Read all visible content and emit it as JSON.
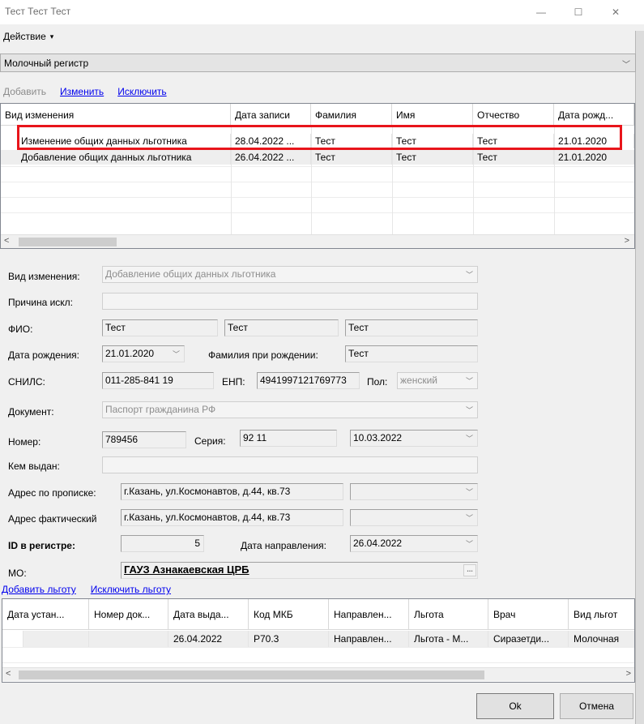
{
  "window": {
    "title": "Тест Тест Тест",
    "min_glyph": "—",
    "max_glyph": "☐",
    "close_glyph": "✕"
  },
  "menu": {
    "action_label": "Действие",
    "caret": "▾"
  },
  "registry": {
    "value": "Молочный регистр",
    "arrow": "﹀"
  },
  "toolbar": {
    "add": "Добавить",
    "edit": "Изменить",
    "exclude": "Исключить"
  },
  "changes_grid": {
    "columns": [
      "Вид изменения",
      "Дата записи",
      "Фамилия",
      "Имя",
      "Отчество",
      "Дата рожд..."
    ],
    "rows": [
      [
        "Изменение общих данных льготника",
        "28.04.2022 ...",
        "Тест",
        "Тест",
        "Тест",
        "21.01.2020"
      ],
      [
        "Добавление общих данных льготника",
        "26.04.2022 ...",
        "Тест",
        "Тест",
        "Тест",
        "21.01.2020"
      ]
    ],
    "scroll_left": "<",
    "scroll_right": ">"
  },
  "form": {
    "change_type_label": "Вид изменения:",
    "change_type_value": "Добавление общих данных льготника",
    "exclusion_reason_label": "Причина искл:",
    "exclusion_reason_value": "",
    "fio_label": "ФИО:",
    "last_name": "Тест",
    "first_name": "Тест",
    "middle_name": "Тест",
    "birth_date_label": "Дата рождения:",
    "birth_date": "21.01.2020",
    "birth_last_name_label": "Фамилия при рождении:",
    "birth_last_name": "Тест",
    "snils_label": "СНИЛС:",
    "snils": "011-285-841 19",
    "enp_label": "ЕНП:",
    "enp": "4941997121769773",
    "sex_label": "Пол:",
    "sex": "женский",
    "document_label": "Документ:",
    "document": "Паспорт гражданина РФ",
    "number_label": "Номер:",
    "number": "789456",
    "series_label": "Серия:",
    "series": "92 11",
    "issue_date": "10.03.2022",
    "issued_by_label": "Кем выдан:",
    "issued_by": "",
    "reg_address_label": "Адрес по прописке:",
    "reg_address": "г.Казань, ул.Космонавтов, д.44, кв.73",
    "actual_address_label": "Адрес фактический",
    "actual_address": "г.Казань, ул.Космонавтов, д.44, кв.73",
    "registry_id_label": "ID в регистре:",
    "registry_id": "5",
    "referral_date_label": "Дата направления:",
    "referral_date": "26.04.2022",
    "mo_label": "МО:",
    "mo": "ГАУЗ Азнакаевская ЦРБ",
    "dots": "..."
  },
  "benefit_toolbar": {
    "add": "Добавить льготу",
    "exclude": "Исключить льготу"
  },
  "benefits_grid": {
    "columns": [
      "Дата устан...",
      "Номер док...",
      "Дата выда...",
      "Код МКБ",
      "Направлен...",
      "Льгота",
      "Врач",
      "Вид льгот"
    ],
    "rows": [
      [
        "",
        "",
        "26.04.2022",
        "P70.3",
        "Направлен...",
        "Льгота - М...",
        "Сиразетди...",
        "Молочная"
      ]
    ],
    "scroll_left": "<",
    "scroll_right": ">"
  },
  "buttons": {
    "ok": "Ok",
    "cancel": "Отмена"
  }
}
